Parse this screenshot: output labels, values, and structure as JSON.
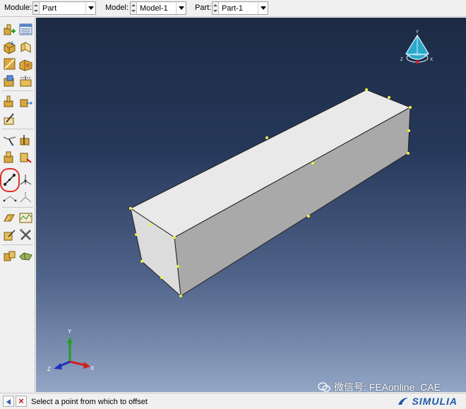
{
  "context_bar": {
    "module": {
      "label": "Module:",
      "value": "Part"
    },
    "model": {
      "label": "Model:",
      "value": "Model-1"
    },
    "part": {
      "label": "Part:",
      "value": "Part-1"
    }
  },
  "toolbox": {
    "highlight_color": "#e0302a",
    "tools": [
      "create-part-icon",
      "part-manager-icon",
      "extrude-solid-icon",
      "revolve-solid-icon",
      "sweep-solid-icon",
      "loft-solid-icon",
      "cut-extrude-icon",
      "cut-revolve-icon",
      "create-shell-icon",
      "create-wire-icon",
      "round-fillet-icon",
      "chamfer-icon",
      "sketch-icon",
      "datum-point-icon",
      "datum-axis-icon",
      "datum-plane-icon",
      "datum-csys-icon",
      "create-offset-point-icon",
      "query-point-icon",
      "partition-icon",
      "partition-face-icon",
      "repair-icon",
      "geometry-edit-icon",
      "virtual-topology-icon",
      "tools-icon",
      "set-icon",
      "surface-icon"
    ]
  },
  "viewport": {
    "triad": {
      "x": "X",
      "y": "Y",
      "z": "Z"
    },
    "compass": {
      "x": "X",
      "y": "Y",
      "z": "Z"
    }
  },
  "prompt": {
    "text": "Select a point from which to offset"
  },
  "watermark": {
    "text": "微信号: FEAonline_CAE"
  },
  "brand": {
    "name": "SIMULIA"
  }
}
